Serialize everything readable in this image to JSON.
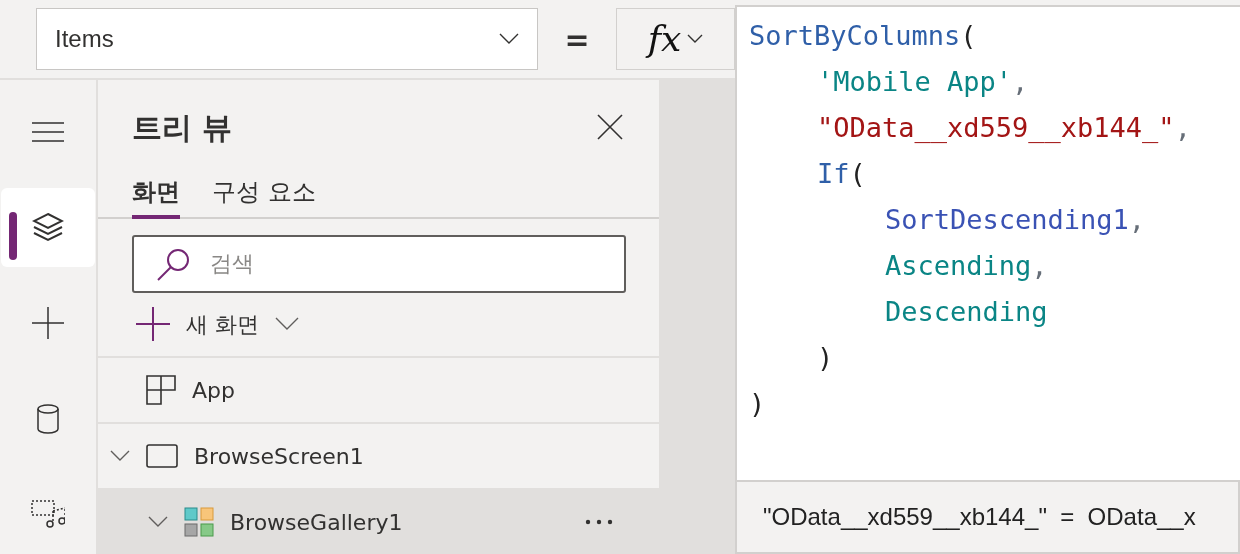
{
  "formula_bar": {
    "property": "Items",
    "equals": "=",
    "fx": "fx"
  },
  "rail": [
    {
      "selected": false
    },
    {
      "selected": true
    },
    {
      "selected": false
    },
    {
      "selected": false
    },
    {
      "selected": false
    }
  ],
  "tree_view": {
    "title": "트리 뷰",
    "tabs": [
      {
        "label": "화면",
        "selected": true
      },
      {
        "label": "구성 요소",
        "selected": false
      }
    ],
    "search": {
      "placeholder": "검색"
    },
    "new_screen": "새 화면",
    "items": [
      {
        "label": "App",
        "kind": "app",
        "selected": false
      },
      {
        "label": "BrowseScreen1",
        "kind": "screen",
        "selected": false,
        "expanded": true,
        "children": [
          {
            "label": "BrowseGallery1",
            "kind": "gallery",
            "selected": true,
            "expanded": true
          }
        ]
      }
    ]
  },
  "code": [
    {
      "tokens": [
        {
          "kind": "function",
          "text": "SortByColumns"
        },
        {
          "kind": "punct",
          "text": "("
        }
      ],
      "children": [
        {
          "tokens": [
            {
              "kind": "identifier",
              "text": "'Mobile App'"
            },
            {
              "kind": "comma",
              "text": ","
            }
          ]
        },
        {
          "tokens": [
            {
              "kind": "string",
              "text": "\"OData__xd559__xb144_\""
            },
            {
              "kind": "comma",
              "text": ","
            }
          ]
        },
        {
          "tokens": [
            {
              "kind": "function",
              "text": "If"
            },
            {
              "kind": "punct",
              "text": "("
            }
          ],
          "children": [
            {
              "tokens": [
                {
                  "kind": "variable",
                  "text": "SortDescending1"
                },
                {
                  "kind": "comma",
                  "text": ","
                }
              ]
            },
            {
              "tokens": [
                {
                  "kind": "identifier",
                  "text": "Ascending"
                },
                {
                  "kind": "comma",
                  "text": ","
                }
              ]
            },
            {
              "tokens": [
                {
                  "kind": "identifier",
                  "text": "Descending"
                }
              ]
            }
          ]
        },
        {
          "tokens": [
            {
              "kind": "punct",
              "text": ")"
            }
          ]
        }
      ]
    },
    {
      "tokens": [
        {
          "kind": "punct",
          "text": ")"
        }
      ]
    }
  ],
  "result": "\"OData__xd559__xb144_\"  =  OData__x"
}
